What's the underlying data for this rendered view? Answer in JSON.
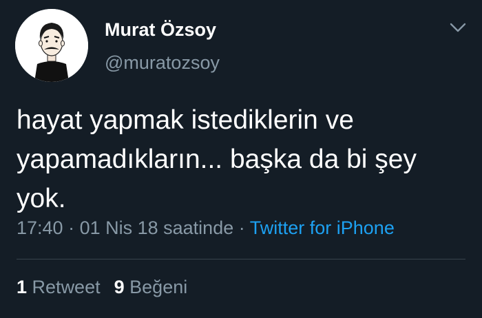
{
  "user": {
    "display_name": "Murat Özsoy",
    "handle": "@muratozsoy",
    "avatar_icon": "cartoon-man-avatar"
  },
  "tweet": {
    "text": "hayat yapmak istediklerin ve yapamadıkların... başka da bi şey yok."
  },
  "meta": {
    "time": "17:40",
    "separator1": " · ",
    "date": "01 Nis 18 saatinde",
    "separator2": " · ",
    "source": "Twitter for iPhone"
  },
  "stats": {
    "retweet_count": "1",
    "retweet_label": "Retweet",
    "like_count": "9",
    "like_label": "Beğeni"
  },
  "icons": {
    "menu": "chevron-down-icon"
  },
  "colors": {
    "background": "#141d26",
    "secondary_text": "#8899a6",
    "link": "#1da1f2",
    "divider": "#38444d"
  }
}
